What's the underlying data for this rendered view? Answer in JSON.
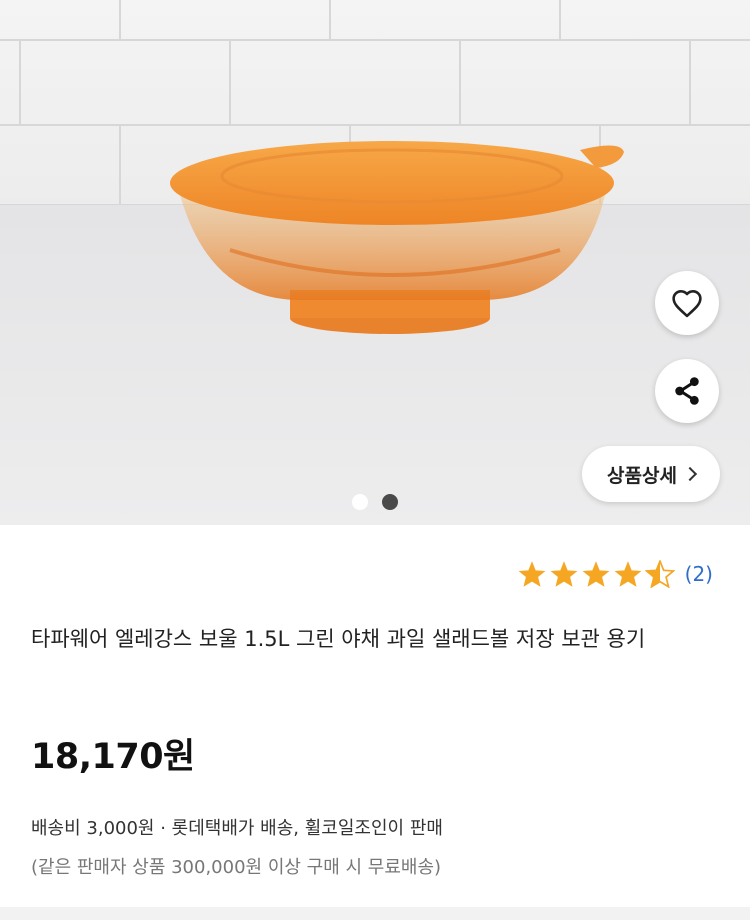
{
  "hero": {
    "photo_alt": "orange lidded bowl",
    "like_icon": "heart-outline-icon",
    "share_icon": "share-icon",
    "detail_button_label": "상품상세",
    "carousel": {
      "total": 2,
      "current": 2
    }
  },
  "rating": {
    "stars": 4.5,
    "max": 5,
    "count_label": "(2)",
    "star_color": "#f5a623",
    "empty_color": "#d9d9d9"
  },
  "product": {
    "title": "타파웨어 엘레강스 보울 1.5L 그린 야채 과일 샐래드볼 저장 보관 용기",
    "price": "18,170원",
    "shipping": "배송비 3,000원 · 롯데택배가 배송, 휠코일조인이 판매",
    "shipping_note": "(같은 판매자 상품 300,000원 이상 구매 시 무료배송)"
  },
  "colors": {
    "accent_link": "#2f6ecb",
    "product_orange": "#f39a3c"
  }
}
